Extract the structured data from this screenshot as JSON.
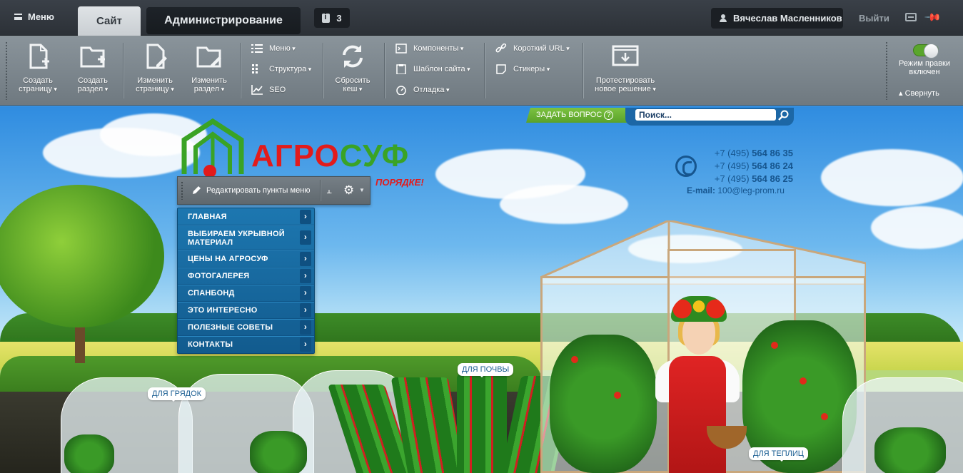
{
  "topbar": {
    "menu_label": "Меню",
    "tab_site": "Сайт",
    "tab_admin": "Администрирование",
    "notifications_count": "3",
    "user_name": "Вячеслав Масленников",
    "logout": "Выйти"
  },
  "toolbar": {
    "create_page": [
      "Создать",
      "страницу"
    ],
    "create_section": [
      "Создать",
      "раздел"
    ],
    "edit_page": [
      "Изменить",
      "страницу"
    ],
    "edit_section": [
      "Изменить",
      "раздел"
    ],
    "menu": "Меню",
    "structure": "Структура",
    "seo": "SEO",
    "reset_cache": [
      "Сбросить",
      "кеш"
    ],
    "components": "Компоненты",
    "site_template": "Шаблон сайта",
    "debug": "Отладка",
    "short_url": "Короткий URL",
    "stickers": "Стикеры",
    "test_solution": [
      "Протестировать",
      "новое решение"
    ],
    "edit_mode": "Режим правки включен",
    "collapse": "Свернуть"
  },
  "site": {
    "logo_part1": "АГРО",
    "logo_part2": "СУФ",
    "slogan": "ПОРЯДКЕ!",
    "ask_question": "ЗАДАТЬ ВОПРОС",
    "search_placeholder": "Поиск...",
    "phones": [
      {
        "prefix": "+7 (495) ",
        "number": "564 86 35"
      },
      {
        "prefix": "+7 (495) ",
        "number": "564 86 24"
      },
      {
        "prefix": "+7 (495) ",
        "number": "564 86 25"
      }
    ],
    "email_label": "E-mail:",
    "email": "100@leg-prom.ru",
    "edit_menu_items": "Редактировать пункты меню",
    "nav": [
      "ГЛАВНАЯ",
      "ВЫБИРАЕМ УКРЫВНОЙ МАТЕРИАЛ",
      "ЦЕНЫ НА АГРОСУФ",
      "ФОТОГАЛЕРЕЯ",
      "СПАНБОНД",
      "ЭТО ИНТЕРЕСНО",
      "ПОЛЕЗНЫЕ СОВЕТЫ",
      "КОНТАКТЫ"
    ],
    "tag_beds": "ДЛЯ ГРЯДОК",
    "tag_soil": "ДЛЯ ПОЧВЫ",
    "tag_greenhouse": "ДЛЯ ТЕПЛИЦ"
  },
  "colors": {
    "accent_green": "#5aa22a",
    "nav_blue": "#1d77b0",
    "logo_red": "#e21b1b",
    "logo_green": "#3aa325"
  }
}
